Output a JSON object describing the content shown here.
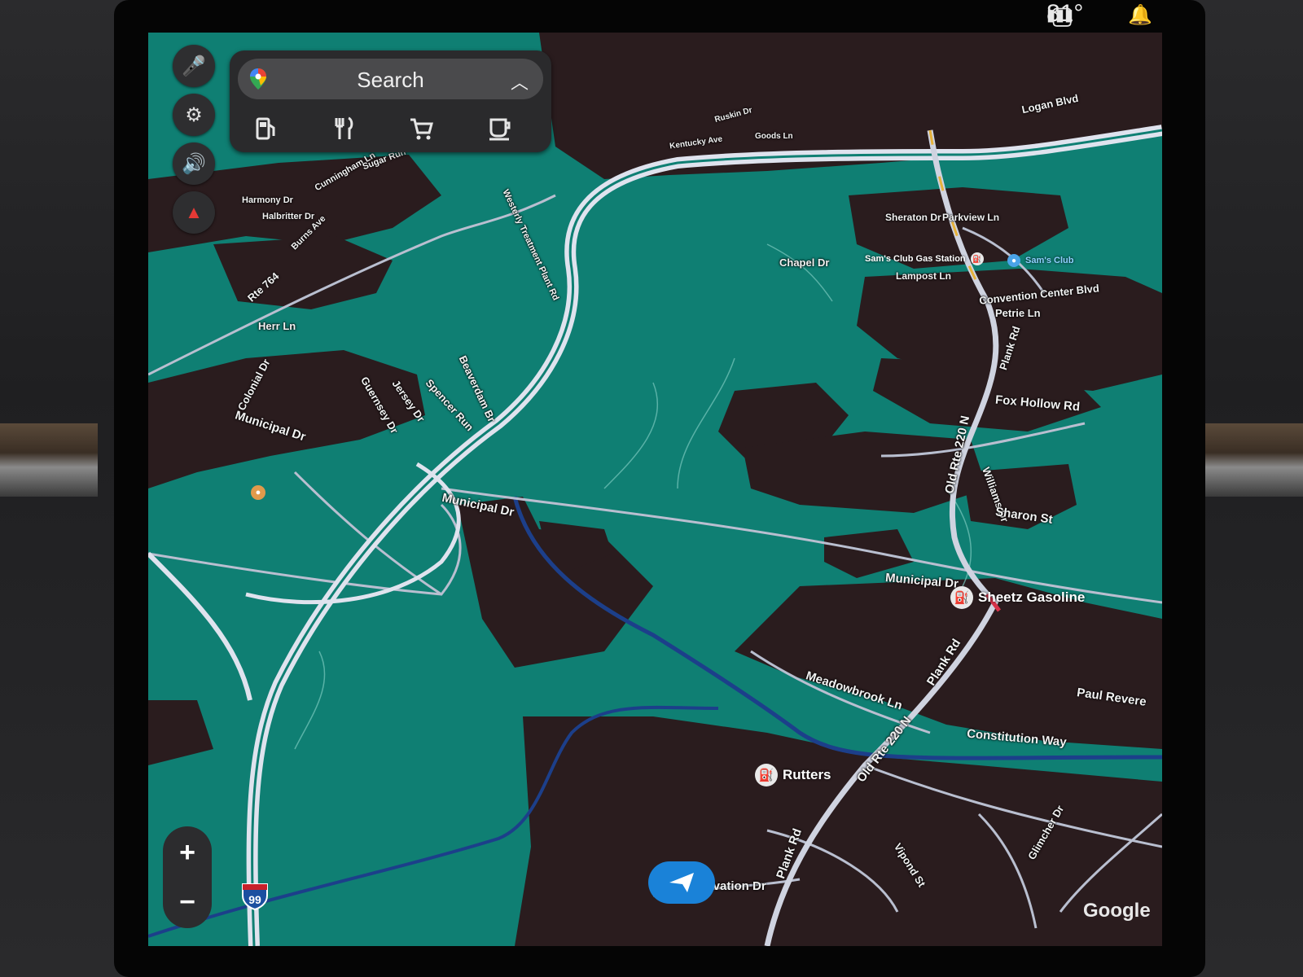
{
  "status_bar": {
    "temperature": "81°"
  },
  "search": {
    "label": "Search"
  },
  "categories": [
    {
      "name": "gas-station-icon",
      "glyph": "⛽"
    },
    {
      "name": "restaurant-icon",
      "glyph": "🍴"
    },
    {
      "name": "shopping-cart-icon",
      "glyph": "🛒"
    },
    {
      "name": "coffee-icon",
      "glyph": "☕"
    }
  ],
  "side_controls": [
    {
      "name": "microphone-icon",
      "glyph": "🎤"
    },
    {
      "name": "settings-icon",
      "glyph": "⚙"
    },
    {
      "name": "volume-icon",
      "glyph": "🔊"
    },
    {
      "name": "compass-icon",
      "glyph": "▲"
    }
  ],
  "zoom": {
    "in": "+",
    "out": "−"
  },
  "attribution": "Google",
  "shield_number": "99",
  "colors": {
    "water": "#0f7f73",
    "land_dark": "#2a1c1e",
    "road": "#cfd3e0",
    "accent": "#1a82d8"
  },
  "roads": {
    "municipal_dr_1": "Municipal Dr",
    "municipal_dr_2": "Municipal Dr",
    "municipal_dr_3": "Municipal Dr",
    "rte_764": "Rte 764",
    "herr_ln": "Herr Ln",
    "colonial_dr": "Colonial Dr",
    "guernsey_dr": "Guernsey Dr",
    "jersey_dr": "Jersey Dr",
    "spencer_run": "Spencer Run",
    "beaverdam_br": "Beaverdam Br",
    "westerly_treatment": "Westerly Treatment Plant Rd",
    "harmony_dr": "Harmony Dr",
    "halbritter_dr": "Halbritter Dr",
    "burns_ave": "Burns Ave",
    "cunningham_ln": "Cunningham Ln",
    "sugar_run": "Sugar Run",
    "chapel_dr": "Chapel Dr",
    "sheraton_dr": "Sheraton Dr",
    "parkview_ln": "Parkview Ln",
    "lampost_ln": "Lampost Ln",
    "convention_center": "Convention Center Blvd",
    "petrie_ln": "Petrie Ln",
    "plank_rd_1": "Plank Rd",
    "plank_rd_2": "Plank Rd",
    "plank_rd_3": "Plank Rd",
    "fox_hollow": "Fox Hollow Rd",
    "old_rte_1": "Old Rte 220 N",
    "old_rte_2": "Old Rte 220 N",
    "williams_dr": "Williams Dr",
    "sharon_st": "Sharon St",
    "meadowbrook": "Meadowbrook Ln",
    "paul_revere": "Paul Revere",
    "constitution_way": "Constitution Way",
    "innovation_dr": "Innovation Dr",
    "vipond_st": "Vipond St",
    "glimcher_dr": "Glimcher Dr",
    "logan_blvd": "Logan Blvd",
    "goods_ln": "Goods Ln",
    "kentucky_ave": "Kentucky Ave",
    "ruskin_dr": "Ruskin Dr"
  },
  "pois": {
    "sheetz": "Sheetz Gasoline",
    "rutters": "Rutters",
    "sams_club": "Sam's Club",
    "sams_gas": "Sam's Club Gas Station"
  }
}
